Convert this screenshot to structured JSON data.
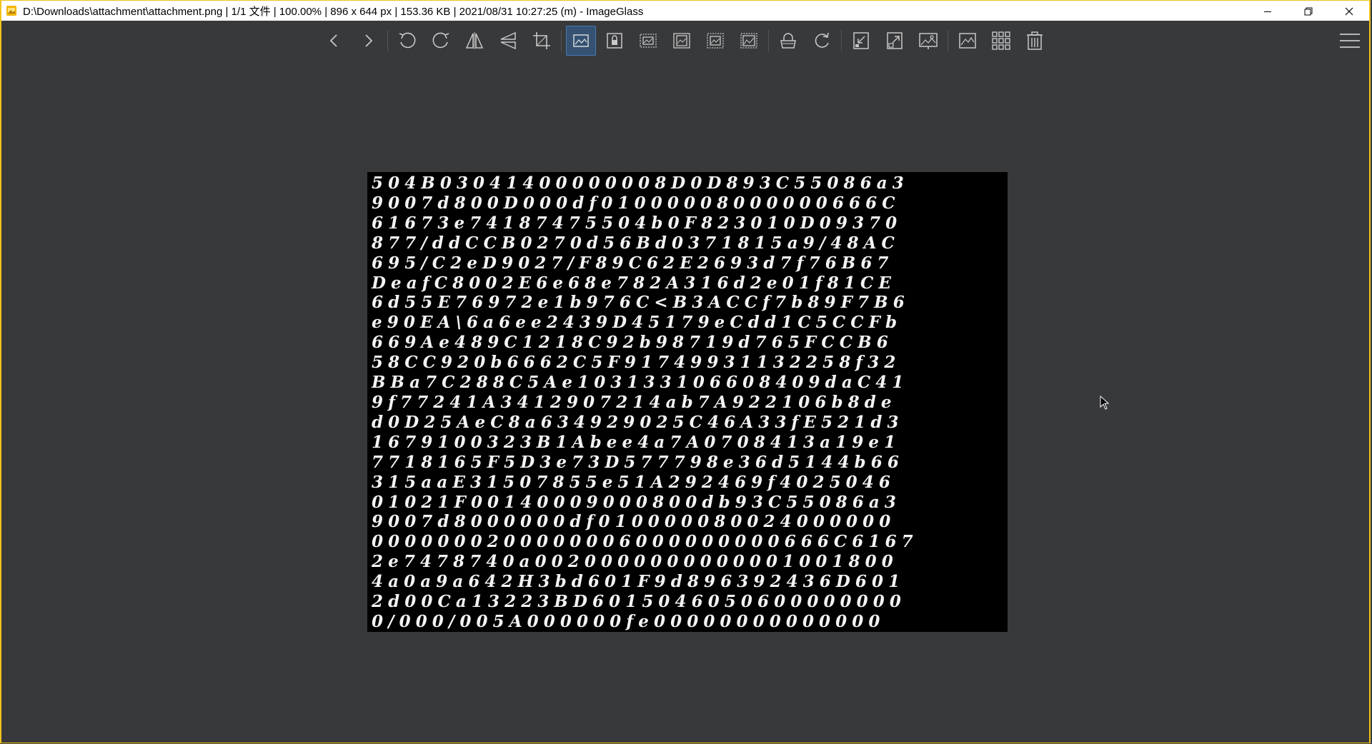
{
  "window": {
    "title": "D:\\Downloads\\attachment\\attachment.png  |  1/1 文件  |  100.00%  |  896 x 644 px  |  153.36 KB  |  2021/08/31 10:27:25 (m)  - ImageGlass",
    "controls": [
      "minimize",
      "restore",
      "close"
    ]
  },
  "toolbar": {
    "buttons": [
      {
        "name": "previous-image",
        "icon": "chevron-left-icon"
      },
      {
        "name": "next-image",
        "icon": "chevron-right-icon"
      },
      {
        "name": "rotate-left",
        "icon": "rotate-ccw-icon"
      },
      {
        "name": "rotate-right",
        "icon": "rotate-cw-icon"
      },
      {
        "name": "flip-horizontal",
        "icon": "flip-horizontal-icon"
      },
      {
        "name": "flip-vertical",
        "icon": "flip-vertical-icon"
      },
      {
        "name": "crop",
        "icon": "crop-icon"
      },
      {
        "name": "auto-zoom",
        "icon": "auto-zoom-icon",
        "active": true
      },
      {
        "name": "lock-zoom",
        "icon": "lock-zoom-icon"
      },
      {
        "name": "scale-to-width",
        "icon": "scale-width-icon"
      },
      {
        "name": "scale-to-height",
        "icon": "scale-height-icon"
      },
      {
        "name": "scale-to-fit",
        "icon": "scale-fit-icon"
      },
      {
        "name": "scale-to-fill",
        "icon": "scale-fill-icon"
      },
      {
        "name": "open-with",
        "icon": "open-with-icon"
      },
      {
        "name": "refresh",
        "icon": "refresh-icon"
      },
      {
        "name": "goto-image",
        "icon": "goto-icon"
      },
      {
        "name": "fullscreen",
        "icon": "fullscreen-icon"
      },
      {
        "name": "slideshow",
        "icon": "slideshow-icon"
      },
      {
        "name": "set-as-desktop",
        "icon": "wallpaper-icon"
      },
      {
        "name": "thumbnail-bar",
        "icon": "thumbnail-grid-icon"
      },
      {
        "name": "delete",
        "icon": "trash-icon"
      }
    ],
    "active_color": "#355273"
  },
  "image": {
    "dimensions": "896 x 644 px",
    "rows": [
      "504B03041400000008D0D893C5 50 8 6 a3",
      "9007d8 00D 000d f 0 1 0 0 0 0 0 8 0 0 0 0 0 0 6 6 6C",
      "6 1 6 7 3 e 7 4 1 8 7 4 7 5 5 0 4 b 0 F 8 2 3 0 1 0 D 0 9 3 7 0",
      "8 7 7 / d d C C B 0 2 7 0 d 5 6 B d 0 3 7 1 8 1 5 a 9 / 4 8 A C",
      "6 9 5 / C 2 e D 9 0 2 7 / F 8 9 C 6 2 E 2 6 9 3 d 7 f 7 6 B 6 7",
      "D e a f C 8 0 0 2 E 6 e 6 8 e 7 8 2 A 3 1 6 d 2 e 0 1 f 8 1 C E",
      "6 d 5 5 E 7 6 9 7 2 e 1 b 9 7 6 C < B 3 A C C f 7 b 8 9 F 7 B 6",
      "e 9 0 E A \\ 6 a 6 e e 2 4 3 9 D 4 5 1 7 9 e C d d 1 C 5 C C F b",
      "6 6 9 A e 4 8 9 C 1 2 1 8 C 9 2 b 9 8 7 1 9 d 7 6 5 F C C B 6",
      "5 8 C C 9 2 0 b 6 6 6 2 C 5 F 9 1 7 4 9 9 3 1 1 3 2 2 5 8 f 3 2",
      "B B a 7 C 2 8 8 C 5 A e 1 0 3 1 3 3 1 0 6 6 0 8 4 0 9 d a C 4 1",
      "9 f 7 7 2 4 1 A 3 4 1 2 9 0 7 2 1 4 a b 7 A 9 2 2 1 0 6 b 8 d e",
      "d 0 D 2 5 A e C 8 a 6 3 4 9 2 9 0 2 5 C 4 6 A 3 3 f E 5 2 1 d 3",
      "1 6 7 9 1 0 0 3 2 3 B 1 A b e e 4 a 7 A 0 7 0 8 4 1 3 a 1 9 e 1",
      "7 7 1 8 1 6 5 F 5 D 3 e 7 3 D 5 7 7 7 9 8 e 3 6 d 5 1 4 4 b 6 6",
      "3 1 5 a a E 3 1 5 0 7 8 5 5 e 5 1 A 2 9 2 4 6 9 f 4 0 2 5 0 4 6",
      "0 1 0 2 1 F 0 0 1 4 0 0 0 9 0 0 0 8 0 0 d b 9 3 C 5 5 0 8 6 a 3",
      "9 0 0 7 d 8 0 0 0 0 0 0 d f 0 1 0 0 0 0 0 8 0 0 2 4 0 0 0 0 0 0",
      "0 0 0 0 0 0 0 2 0 0 0 0 0 0 0 6 0 0 0 0 0 0 0 0 0 6 6 6 C 6 1 6 7",
      "2 e 7 4 7 8 7 4 0 a 0 0 2 0 0 0 0 0 0 0 0 0 0 0 0 1 0 0 1 8 0 0",
      "4 a 0 a 9 a 6 4 2 H 3 b d 6 0 1 F 9 d 8 9 6 3 9 2 4 3 6 D 6 0 1",
      "2 d 0 0 C a 1 3 2 2 3 B D 6 0 1 5 0 4 6 0 5 0 6 0 0 0 0 0 0 0 0",
      "0 / 0 0 0 / 0 0 5 A 0 0 0 0 0 0 f e 0 0 0 0 0 0 0 0 0 0 0 0 0 0"
    ]
  }
}
